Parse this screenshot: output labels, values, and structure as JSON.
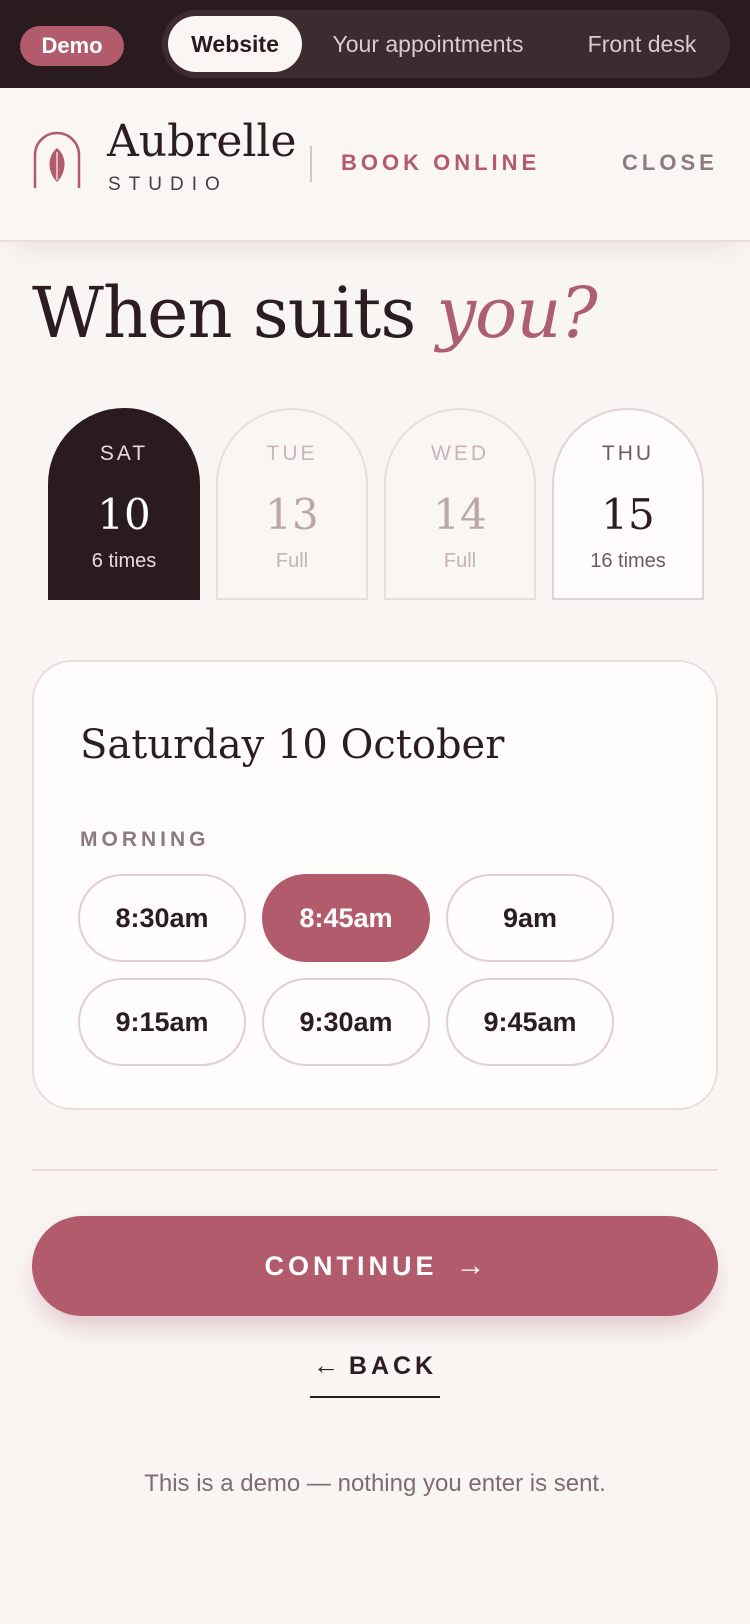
{
  "demo_bar": {
    "badge": "Demo",
    "tabs": [
      {
        "label": "Website",
        "active": true
      },
      {
        "label": "Your appointments",
        "active": false
      },
      {
        "label": "Front desk",
        "active": false
      }
    ]
  },
  "header": {
    "brand_name": "Aubrelle",
    "brand_sub": "STUDIO",
    "book_online": "BOOK ONLINE",
    "close": "CLOSE",
    "logo_icon": "leaf-arch-icon"
  },
  "heading": {
    "main": "When suits ",
    "accent": "you?"
  },
  "days": [
    {
      "dow": "SAT",
      "num": "10",
      "note": "6 times",
      "state": "selected"
    },
    {
      "dow": "TUE",
      "num": "13",
      "note": "Full",
      "state": "full"
    },
    {
      "dow": "WED",
      "num": "14",
      "note": "Full",
      "state": "full"
    },
    {
      "dow": "THU",
      "num": "15",
      "note": "16 times",
      "state": "available"
    }
  ],
  "panel": {
    "date": "Saturday 10 October",
    "section": "MORNING",
    "slots": [
      {
        "label": "8:30am",
        "selected": false
      },
      {
        "label": "8:45am",
        "selected": true
      },
      {
        "label": "9am",
        "selected": false
      },
      {
        "label": "9:15am",
        "selected": false
      },
      {
        "label": "9:30am",
        "selected": false
      },
      {
        "label": "9:45am",
        "selected": false
      }
    ]
  },
  "actions": {
    "continue": "CONTINUE",
    "back": "BACK"
  },
  "footnote": "This is a demo — nothing you enter is sent.",
  "colors": {
    "accent": "#b25b6d",
    "dark": "#2a1b1f",
    "background": "#f9f5f3"
  }
}
